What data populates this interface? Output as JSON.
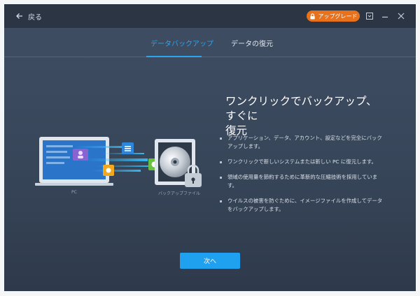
{
  "titlebar": {
    "back_label": "戻る",
    "upgrade_label": "アップグレード",
    "accent_color": "#e8711c"
  },
  "tabs": [
    {
      "label": "データバックアップ",
      "active": true
    },
    {
      "label": "データの復元",
      "active": false
    }
  ],
  "illustration": {
    "pc_caption": "PC",
    "backup_file_caption": "バックアップファイル"
  },
  "main": {
    "heading_line1": "ワンクリックでバックアップ、すぐに",
    "heading_line2": "復元",
    "bullets": [
      "アプリケーション、データ、アカウント、設定などを完全にバックアップします。",
      "ワンクリックで新しいシステムまたは新しい PC に復元します。",
      "領域の使用量を節約するために革新的な圧縮技術を採用しています。",
      "ウイルスの被害を防ぐために、イメージファイルを作成してデータをバックアップします。"
    ]
  },
  "footer": {
    "next_label": "次へ",
    "button_color": "#1fa1f0"
  },
  "icons": [
    "arrow-left-icon",
    "lock-icon",
    "minimize-to-tray-icon",
    "minimize-icon",
    "close-icon",
    "laptop-icon",
    "disc-icon",
    "padlock-icon"
  ]
}
